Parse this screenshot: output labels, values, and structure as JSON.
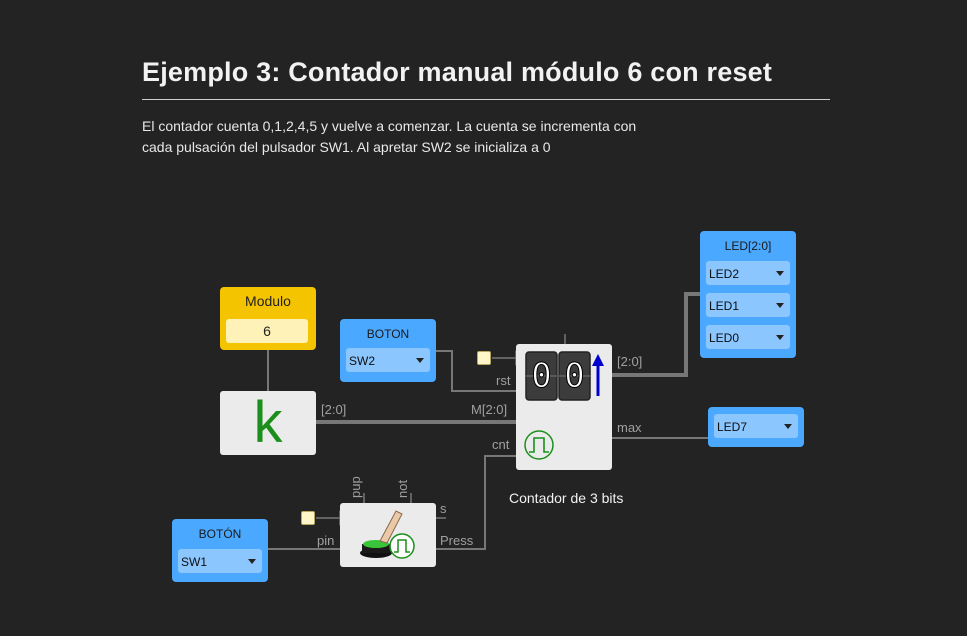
{
  "heading": "Ejemplo 3: Contador manual módulo 6 con reset",
  "description": [
    "El contador cuenta 0,1,2,4,5 y vuelve a comenzar. La cuenta se incrementa con",
    "cada pulsación del pulsador SW1. Al apretar SW2 se inicializa a 0"
  ],
  "modulo": {
    "title": "Modulo",
    "value": "6"
  },
  "const_k": {
    "glyph": "k"
  },
  "boton_sw2": {
    "title": "BOTON",
    "selected": "SW2"
  },
  "boton_sw1": {
    "title": "BOTÓN",
    "selected": "SW1"
  },
  "led_bus": {
    "title": "LED[2:0]",
    "items": [
      "LED2",
      "LED1",
      "LED0"
    ]
  },
  "led7": {
    "selected": "LED7"
  },
  "counter": {
    "digits": [
      "0",
      "0"
    ],
    "caption": "Contador de 3 bits",
    "ports": {
      "rst": "rst",
      "m": "M[2:0]",
      "cnt": "cnt",
      "out": "[2:0]",
      "max": "max"
    }
  },
  "button_block": {
    "ports": {
      "pup": "pup",
      "not": "not",
      "s": "s",
      "pin": "pin",
      "press": "Press"
    }
  },
  "k_bus_label": "[2:0]",
  "colors": {
    "io": "#4aa8ff",
    "const": "#f5c400",
    "wire": "#777777",
    "k": "#1b8f1b",
    "arrow": "#0000cc"
  }
}
